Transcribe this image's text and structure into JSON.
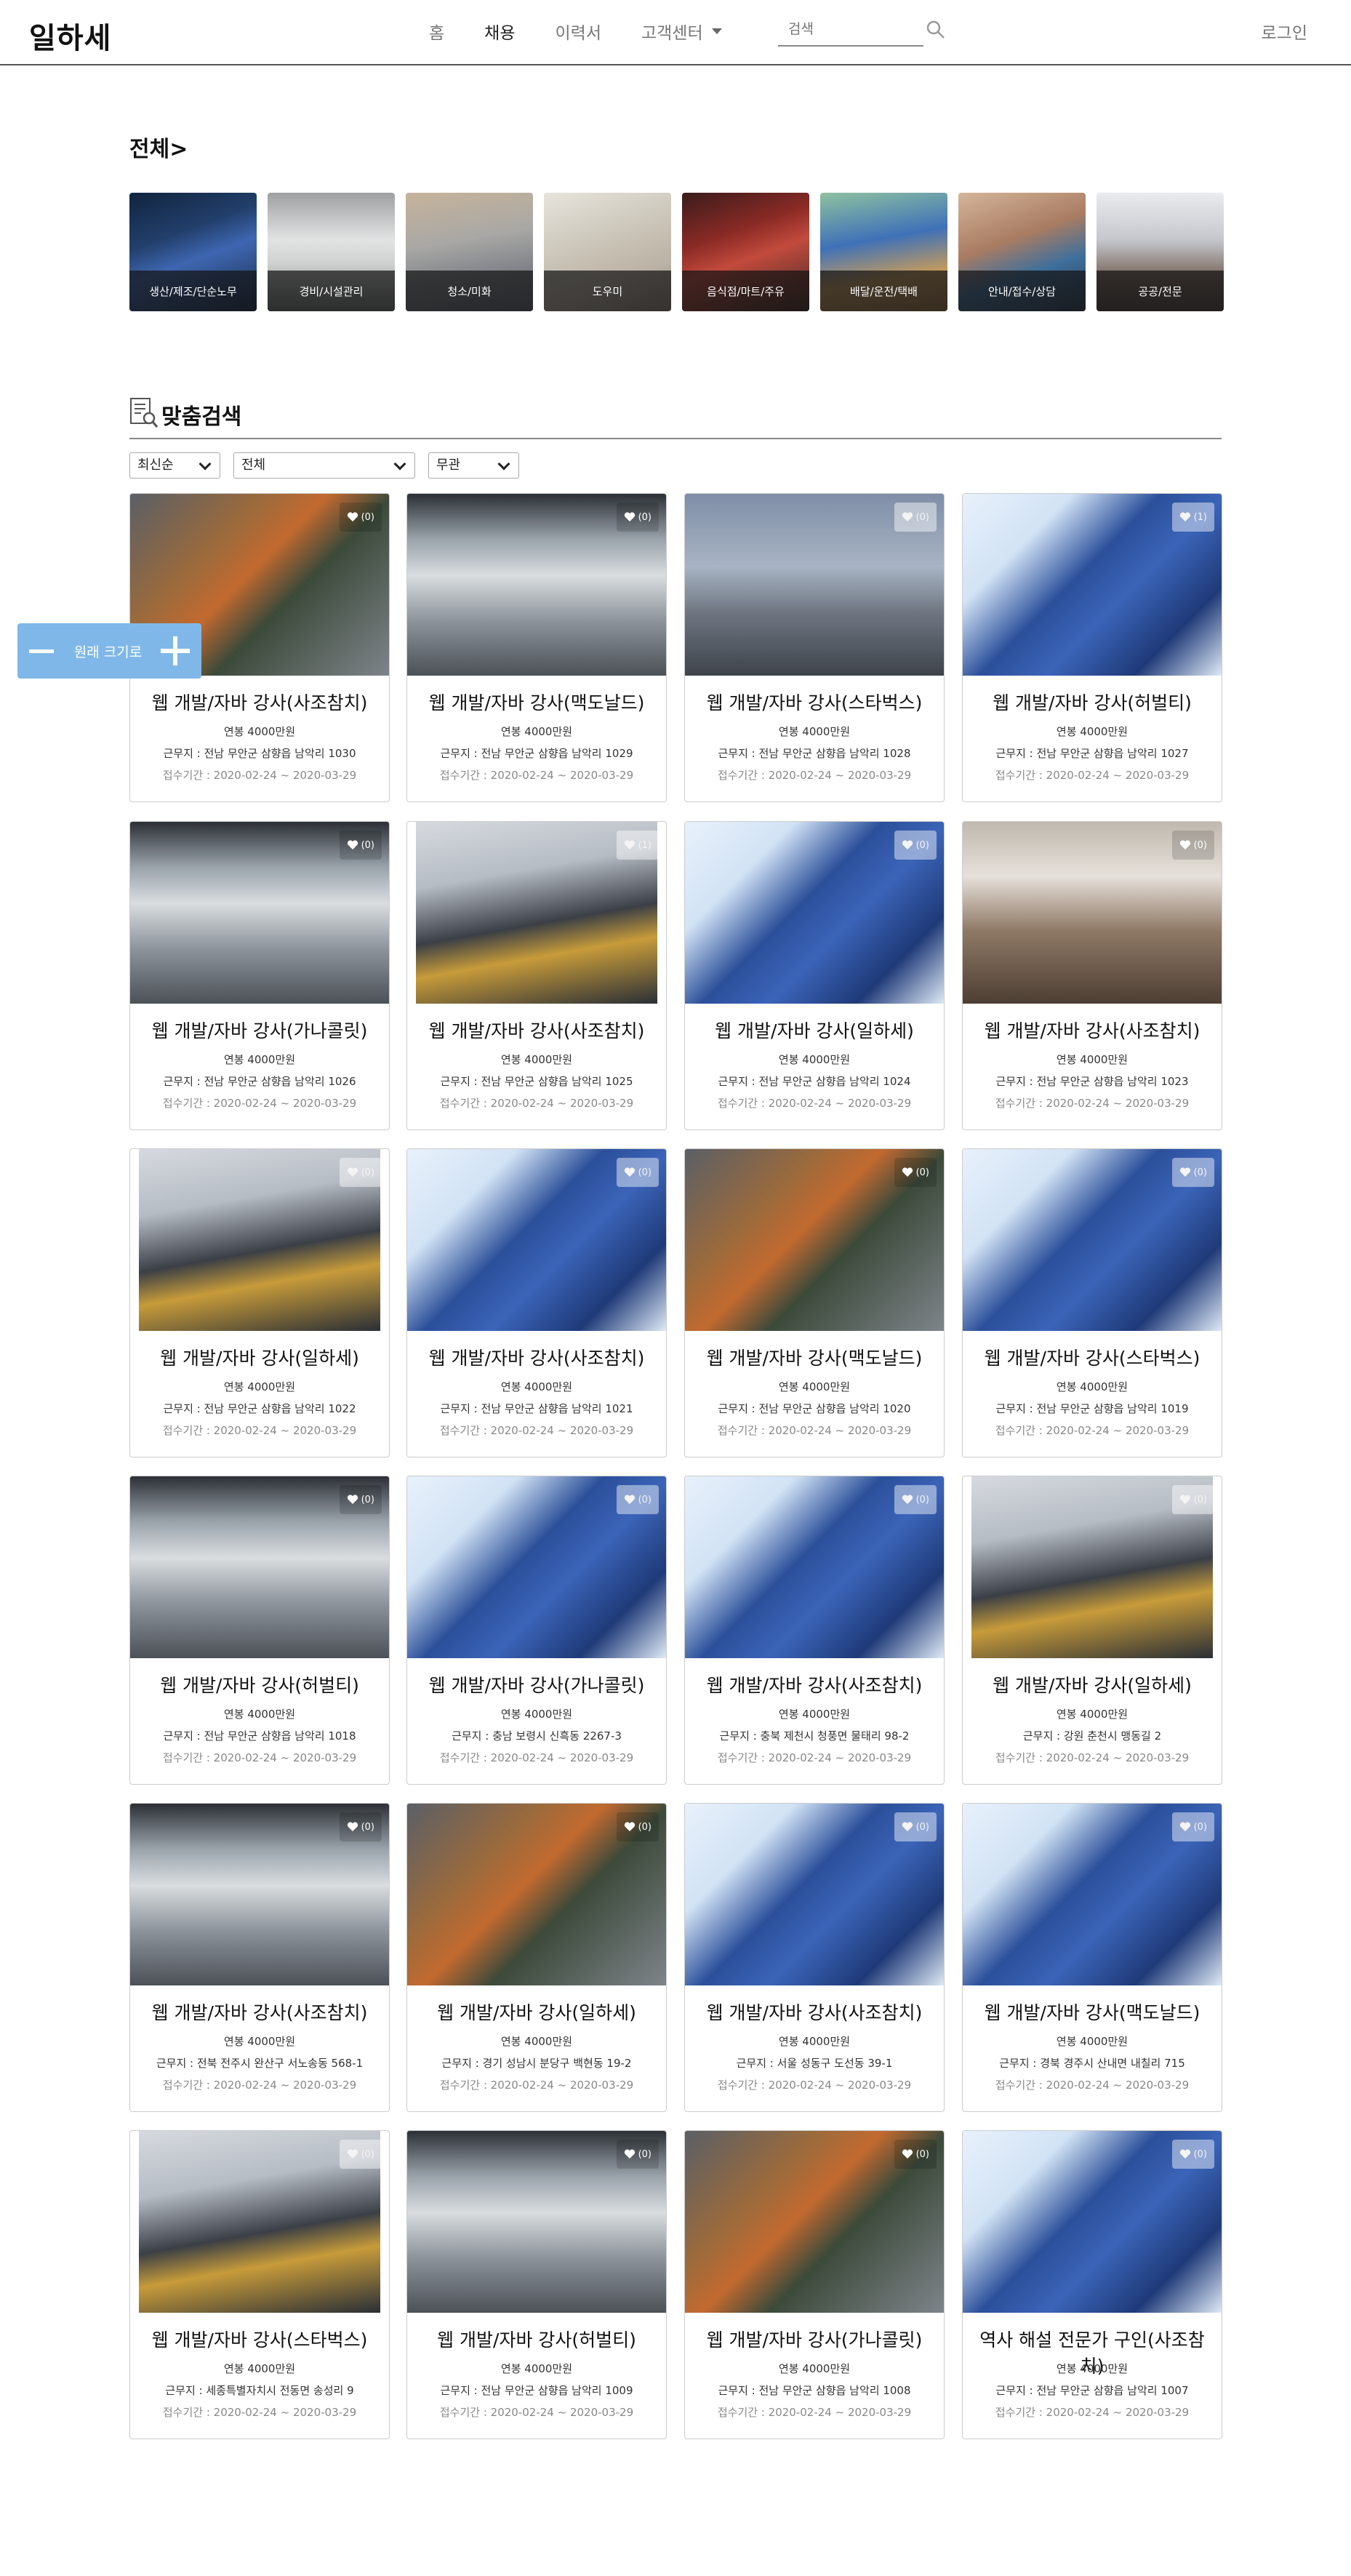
{
  "header": {
    "logo": "일하세",
    "nav": [
      "홈",
      "채용",
      "이력서",
      "고객센터"
    ],
    "active_nav": "채용",
    "search_placeholder": "검색",
    "login": "로그인"
  },
  "category_section": {
    "title": "전체>",
    "items": [
      {
        "label": "생산/제조/단순노무",
        "icon": "photo-factory"
      },
      {
        "label": "경비/시설관리",
        "icon": "photo-security"
      },
      {
        "label": "청소/미화",
        "icon": "photo-cleaning"
      },
      {
        "label": "도우미",
        "icon": "photo-helper"
      },
      {
        "label": "음식점/마트/주유",
        "icon": "photo-restaurant"
      },
      {
        "label": "배달/운전/택배",
        "icon": "photo-delivery"
      },
      {
        "label": "안내/접수/상담",
        "icon": "photo-reception"
      },
      {
        "label": "공공/전문",
        "icon": "photo-public"
      }
    ]
  },
  "custom_search": {
    "title": "맞춤검색",
    "filters": {
      "sort": "최신순",
      "region": "전체",
      "salary": "무관"
    }
  },
  "zoom_widget": {
    "label": "원래 크기로"
  },
  "cards": [
    {
      "title": "웹 개발/자바 강사(사조참치)",
      "salary": "연봉 4000만원",
      "location": "근무지 : 전남 무안군 삼향읍 남악리 1030",
      "period": "접수기간 : 2020-02-24 ~ 2020-03-29",
      "likes": "(0)",
      "image": "topdown"
    },
    {
      "title": "웹 개발/자바 강사(맥도날드)",
      "salary": "연봉 4000만원",
      "location": "근무지 : 전남 무안군 삼향읍 남악리 1029",
      "period": "접수기간 : 2020-02-24 ~ 2020-03-29",
      "likes": "(0)",
      "image": "officehall"
    },
    {
      "title": "웹 개발/자바 강사(스타벅스)",
      "salary": "연봉 4000만원",
      "location": "근무지 : 전남 무안군 삼향읍 남악리 1028",
      "period": "접수기간 : 2020-02-24 ~ 2020-03-29",
      "likes": "(0)",
      "image": "skyline"
    },
    {
      "title": "웹 개발/자바 강사(허벌티)",
      "salary": "연봉 4000만원",
      "location": "근무지 : 전남 무안군 삼향읍 남악리 1027",
      "period": "접수기간 : 2020-02-24 ~ 2020-03-29",
      "likes": "(1)",
      "image": "building"
    },
    {
      "title": "웹 개발/자바 강사(가나콜릿)",
      "salary": "연봉 4000만원",
      "location": "근무지 : 전남 무안군 삼향읍 남악리 1026",
      "period": "접수기간 : 2020-02-24 ~ 2020-03-29",
      "likes": "(0)",
      "image": "officehall"
    },
    {
      "title": "웹 개발/자바 강사(사조참치)",
      "salary": "연봉 4000만원",
      "location": "근무지 : 전남 무안군 삼향읍 남악리 1025",
      "period": "접수기간 : 2020-02-24 ~ 2020-03-29",
      "likes": "(1)",
      "image": "meeting"
    },
    {
      "title": "웹 개발/자바 강사(일하세)",
      "salary": "연봉 4000만원",
      "location": "근무지 : 전남 무안군 삼향읍 남악리 1024",
      "period": "접수기간 : 2020-02-24 ~ 2020-03-29",
      "likes": "(0)",
      "image": "building"
    },
    {
      "title": "웹 개발/자바 강사(사조참치)",
      "salary": "연봉 4000만원",
      "location": "근무지 : 전남 무안군 삼향읍 남악리 1023",
      "period": "접수기간 : 2020-02-24 ~ 2020-03-29",
      "likes": "(0)",
      "image": "boardroom"
    },
    {
      "title": "웹 개발/자바 강사(일하세)",
      "salary": "연봉 4000만원",
      "location": "근무지 : 전남 무안군 삼향읍 남악리 1022",
      "period": "접수기간 : 2020-02-24 ~ 2020-03-29",
      "likes": "(0)",
      "image": "meeting"
    },
    {
      "title": "웹 개발/자바 강사(사조참치)",
      "salary": "연봉 4000만원",
      "location": "근무지 : 전남 무안군 삼향읍 남악리 1021",
      "period": "접수기간 : 2020-02-24 ~ 2020-03-29",
      "likes": "(0)",
      "image": "building"
    },
    {
      "title": "웹 개발/자바 강사(맥도날드)",
      "salary": "연봉 4000만원",
      "location": "근무지 : 전남 무안군 삼향읍 남악리 1020",
      "period": "접수기간 : 2020-02-24 ~ 2020-03-29",
      "likes": "(0)",
      "image": "topdown"
    },
    {
      "title": "웹 개발/자바 강사(스타벅스)",
      "salary": "연봉 4000만원",
      "location": "근무지 : 전남 무안군 삼향읍 남악리 1019",
      "period": "접수기간 : 2020-02-24 ~ 2020-03-29",
      "likes": "(0)",
      "image": "building"
    },
    {
      "title": "웹 개발/자바 강사(허벌티)",
      "salary": "연봉 4000만원",
      "location": "근무지 : 전남 무안군 삼향읍 남악리 1018",
      "period": "접수기간 : 2020-02-24 ~ 2020-03-29",
      "likes": "(0)",
      "image": "officehall"
    },
    {
      "title": "웹 개발/자바 강사(가나콜릿)",
      "salary": "연봉 4000만원",
      "location": "근무지 : 충남 보령시 신흑동 2267-3",
      "period": "접수기간 : 2020-02-24 ~ 2020-03-29",
      "likes": "(0)",
      "image": "building"
    },
    {
      "title": "웹 개발/자바 강사(사조참치)",
      "salary": "연봉 4000만원",
      "location": "근무지 : 충북 제천시 청풍면 물태리 98-2",
      "period": "접수기간 : 2020-02-24 ~ 2020-03-29",
      "likes": "(0)",
      "image": "building"
    },
    {
      "title": "웹 개발/자바 강사(일하세)",
      "salary": "연봉 4000만원",
      "location": "근무지 : 강원 춘천시 맹동길 2",
      "period": "접수기간 : 2020-02-24 ~ 2020-03-29",
      "likes": "(0)",
      "image": "meeting"
    },
    {
      "title": "웹 개발/자바 강사(사조참치)",
      "salary": "연봉 4000만원",
      "location": "근무지 : 전북 전주시 완산구 서노송동 568-1",
      "period": "접수기간 : 2020-02-24 ~ 2020-03-29",
      "likes": "(0)",
      "image": "officehall"
    },
    {
      "title": "웹 개발/자바 강사(일하세)",
      "salary": "연봉 4000만원",
      "location": "근무지 : 경기 성남시 분당구 백현동 19-2",
      "period": "접수기간 : 2020-02-24 ~ 2020-03-29",
      "likes": "(0)",
      "image": "topdown"
    },
    {
      "title": "웹 개발/자바 강사(사조참치)",
      "salary": "연봉 4000만원",
      "location": "근무지 : 서울 성동구 도선동 39-1",
      "period": "접수기간 : 2020-02-24 ~ 2020-03-29",
      "likes": "(0)",
      "image": "building"
    },
    {
      "title": "웹 개발/자바 강사(맥도날드)",
      "salary": "연봉 4000만원",
      "location": "근무지 : 경북 경주시 산내면 내칠리 715",
      "period": "접수기간 : 2020-02-24 ~ 2020-03-29",
      "likes": "(0)",
      "image": "building"
    },
    {
      "title": "웹 개발/자바 강사(스타벅스)",
      "salary": "연봉 4000만원",
      "location": "근무지 : 세종특별자치시 전동면 송성리 9",
      "period": "접수기간 : 2020-02-24 ~ 2020-03-29",
      "likes": "(0)",
      "image": "meeting"
    },
    {
      "title": "웹 개발/자바 강사(허벌티)",
      "salary": "연봉 4000만원",
      "location": "근무지 : 전남 무안군 삼향읍 남악리 1009",
      "period": "접수기간 : 2020-02-24 ~ 2020-03-29",
      "likes": "(0)",
      "image": "officehall"
    },
    {
      "title": "웹 개발/자바 강사(가나콜릿)",
      "salary": "연봉 4000만원",
      "location": "근무지 : 전남 무안군 삼향읍 남악리 1008",
      "period": "접수기간 : 2020-02-24 ~ 2020-03-29",
      "likes": "(0)",
      "image": "topdown"
    },
    {
      "title": "역사 해설 전문가 구인(사조참치)",
      "salary": "연봉 4000만원",
      "location": "근무지 : 전남 무안군 삼향읍 남악리 1007",
      "period": "접수기간 : 2020-02-24 ~ 2020-03-29",
      "likes": "(0)",
      "image": "building"
    }
  ]
}
